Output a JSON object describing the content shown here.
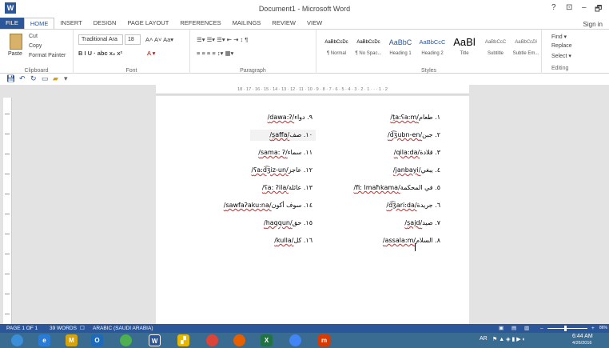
{
  "window": {
    "title": "Document1 - Microsoft Word",
    "controls": [
      "?",
      "⊡",
      "–",
      "🗗"
    ],
    "sign_in": "Sign in"
  },
  "tabs": [
    "FILE",
    "HOME",
    "INSERT",
    "DESIGN",
    "PAGE LAYOUT",
    "REFERENCES",
    "MAILINGS",
    "REVIEW",
    "VIEW"
  ],
  "ribbon": {
    "clipboard": {
      "paste": "Paste",
      "cut": "Cut",
      "copy": "Copy",
      "format_painter": "Format Painter",
      "label": "Clipboard"
    },
    "font": {
      "name": "Traditional Ara",
      "size": "18",
      "label": "Font",
      "buttons": "B  I  U  ·  abc  x₂  x²"
    },
    "paragraph": {
      "label": "Paragraph"
    },
    "styles": {
      "label": "Styles",
      "items": [
        {
          "preview": "AaBbCcDc",
          "name": "¶ Normal"
        },
        {
          "preview": "AaBbCcDc",
          "name": "¶ No Spac..."
        },
        {
          "preview": "AaBbC",
          "name": "Heading 1"
        },
        {
          "preview": "AaBbCcC",
          "name": "Heading 2"
        },
        {
          "preview": "AaBl",
          "name": "Title"
        },
        {
          "preview": "AaBbCcC",
          "name": "Subtitle"
        },
        {
          "preview": "AaBbCcDi",
          "name": "Subtle Em..."
        }
      ]
    },
    "editing": {
      "label": "Editing",
      "find": "Find ▾",
      "replace": "Replace",
      "select": "Select ▾"
    }
  },
  "ruler": "18 · 17 · 16 · 15 · 14 · 13 · 12 · 11 · 10 · 9 · 8 · 7 · 6 · 5 · 4 · 3 · 2 · 1 · · · 1 · 2",
  "document": {
    "right_column": [
      {
        "num": "١. ",
        "ar": "طعام",
        "tr": "/t̤a:ʕa:m/"
      },
      {
        "num": "٢. ",
        "ar": "جبن",
        "tr": "/d͡ʒubn-en/"
      },
      {
        "num": "٣. ",
        "ar": "قلادة",
        "tr": "/qila:da/"
      },
      {
        "num": "٤. ",
        "ar": "يبغي",
        "tr": "/janbayi/"
      },
      {
        "num": "٥. ",
        "ar": "في المحكمة",
        "tr": "/fi: lmaħkama/"
      },
      {
        "num": "٦. ",
        "ar": "جريدة",
        "tr": "/d͡ʒari:da/"
      },
      {
        "num": "٧. ",
        "ar": "صيد",
        "tr": "/s̤ajd/"
      },
      {
        "num": "٨. ",
        "ar": "السلام",
        "tr": "/assala:m/"
      }
    ],
    "left_column": [
      {
        "num": "٩. ",
        "ar": "دواء",
        "tr": "/dawa:ʔ/"
      },
      {
        "num": "١٠. ",
        "ar": "صف",
        "tr": "/s̤affa/"
      },
      {
        "num": "١١. ",
        "ar": "سماء",
        "tr": "/sama: ʔ/"
      },
      {
        "num": "١٢. ",
        "ar": "عاجز",
        "tr": "/ʕa:d͡ʒiz-un/"
      },
      {
        "num": "١٣. ",
        "ar": "عائلة",
        "tr": "/ʕa: ʔila/"
      },
      {
        "num": "١٤. ",
        "ar": "سوف أكون",
        "tr": "/sawfaʔaku:na/"
      },
      {
        "num": "١٥. ",
        "ar": "حق",
        "tr": "/haqqun/"
      },
      {
        "num": "١٦. ",
        "ar": "كل",
        "tr": "/kulla/"
      }
    ]
  },
  "status": {
    "page": "PAGE 1 OF 1",
    "words": "39 WORDS",
    "language": "ARABIC (SAUDI ARABIA)",
    "zoom_minus": "–",
    "zoom_plus": "+",
    "zoom": "86%"
  },
  "taskbar": {
    "icons": [
      "start-orb",
      "ie",
      "media",
      "outlook",
      "chrome-a",
      "word",
      "paint",
      "chrome",
      "firefox",
      "excel",
      "chrome-b",
      "ms"
    ],
    "lang": "AR",
    "time": "6:44 AM",
    "date": "4/26/2016"
  }
}
